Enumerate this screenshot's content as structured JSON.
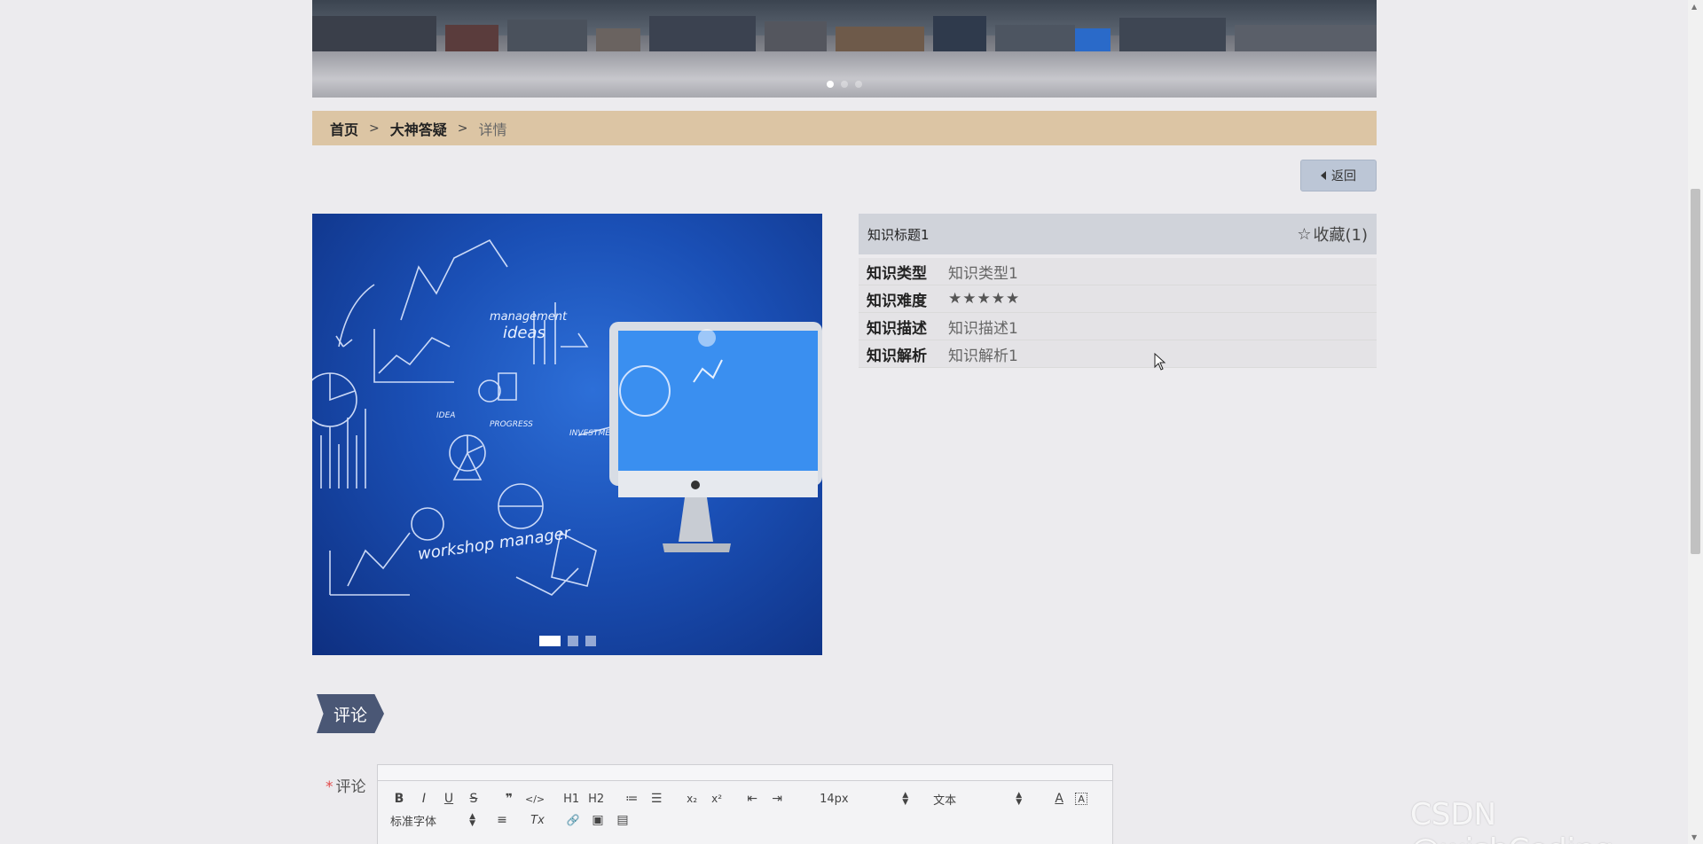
{
  "banner": {
    "slides": 3,
    "active_slide": 1
  },
  "breadcrumb": {
    "home": "首页",
    "section": "大神答疑",
    "current": "详情",
    "separator": ">"
  },
  "back_button": {
    "label": "返回"
  },
  "gallery": {
    "slides": 3,
    "active_slide": 1
  },
  "detail": {
    "title": "知识标题1",
    "favorite_label": "收藏(1)",
    "rows": [
      {
        "label": "知识类型",
        "value": "知识类型1"
      },
      {
        "label": "知识难度",
        "value": "★★★★★"
      },
      {
        "label": "知识描述",
        "value": "知识描述1"
      },
      {
        "label": "知识解析",
        "value": "知识解析1"
      }
    ]
  },
  "comment": {
    "tag": "评论",
    "field_label": "评论",
    "required_mark": "*",
    "toolbar": {
      "bold": "B",
      "italic": "I",
      "underline": "U",
      "strike": "S",
      "quote": "❞",
      "code": "</>",
      "h1": "H1",
      "h2": "H2",
      "ordered": "≔",
      "bullet": "☰",
      "subscript": "x₂",
      "superscript": "x²",
      "outdent": "⇤",
      "indent": "⇥",
      "font_size": "14px",
      "text_style": "文本",
      "font_color": "A",
      "bg_color": "A",
      "font_family": "标准字体",
      "align": "≡",
      "clear": "Tx",
      "link": "🔗",
      "image": "▣",
      "video": "▤"
    }
  },
  "watermark": "CSDN @wishCoding",
  "colors": {
    "breadcrumb_bg": "#dcc5a4",
    "tag_bg": "#4a5775",
    "back_btn_bg": "#bcc6d6",
    "required": "#e24b4b"
  }
}
